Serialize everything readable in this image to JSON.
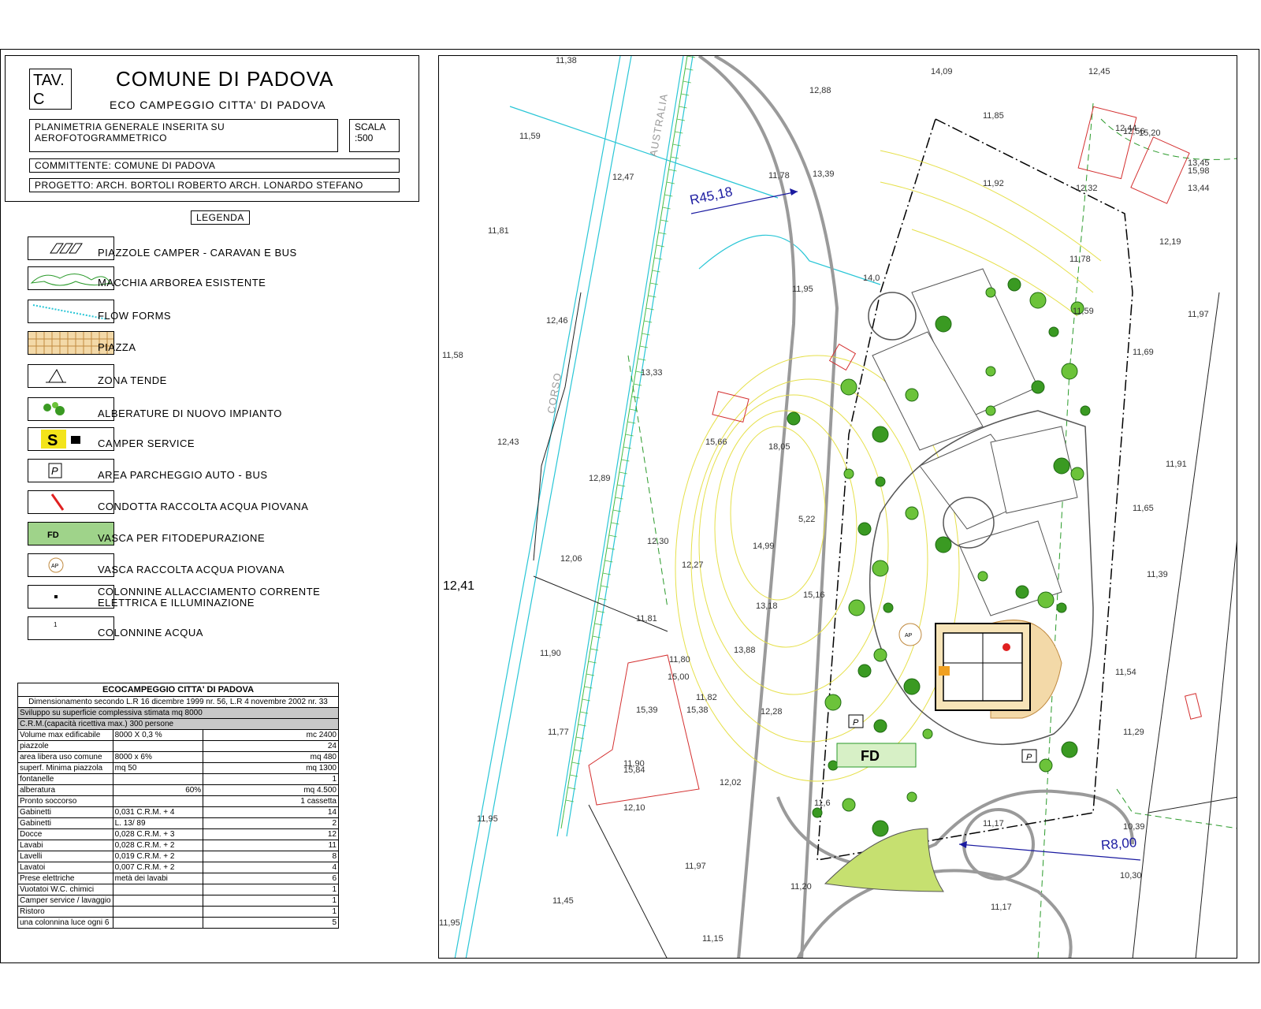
{
  "title": {
    "tav_line1": "TAV.",
    "tav_line2": "C",
    "comune": "COMUNE DI PADOVA",
    "subtitle": "ECO CAMPEGGIO CITTA' DI PADOVA",
    "plan_line1": "PLANIMETRIA GENERALE INSERITA SU",
    "plan_line2": "AEROFOTOGRAMMETRICO",
    "scala_label": "SCALA",
    "scala_value": ":500",
    "committente": "COMMITTENTE:   COMUNE DI PADOVA",
    "progetto": "PROGETTO:   ARCH. BORTOLI ROBERTO    ARCH. LONARDO STEFANO"
  },
  "legend": {
    "title": "LEGENDA",
    "items": [
      {
        "label": "PIAZZOLE CAMPER - CARAVAN E BUS",
        "icon": "camper-pitch-icon"
      },
      {
        "label": "MACCHIA ARBOREA ESISTENTE",
        "icon": "existing-woodland-icon"
      },
      {
        "label": "FLOW   FORMS",
        "icon": "flow-forms-icon"
      },
      {
        "label": "PIAZZA",
        "icon": "piazza-grid-icon"
      },
      {
        "label": "ZONA TENDE",
        "icon": "tent-icon"
      },
      {
        "label": "ALBERATURE DI NUOVO IMPIANTO",
        "icon": "new-trees-icon"
      },
      {
        "label": "CAMPER SERVICE",
        "icon": "camper-service-icon"
      },
      {
        "label": "AREA PARCHEGGIO AUTO - BUS",
        "icon": "parking-icon",
        "glyph": "P"
      },
      {
        "label": "CONDOTTA RACCOLTA ACQUA PIOVANA",
        "icon": "rainwater-pipe-icon"
      },
      {
        "label": "VASCA PER FITODEPURAZIONE",
        "icon": "phytodepuration-tank-icon",
        "glyph": "FD"
      },
      {
        "label": "VASCA RACCOLTA  ACQUA PIOVANA",
        "icon": "rainwater-tank-icon",
        "glyph": "AP"
      },
      {
        "label": "COLONNINE ALLACCIAMENTO CORRENTE\nELETTRICA E ILLUMINAZIONE",
        "icon": "power-column-icon"
      },
      {
        "label": "COLONNINE ACQUA",
        "icon": "water-column-icon",
        "glyph": "1"
      }
    ]
  },
  "table": {
    "title": "ECOCAMPEGGIO CITTA' DI PADOVA",
    "subtitle": "Dimensionamento secondo L.R 16 dicembre 1999 nr. 56, L.R 4 novembre 2002  nr. 33",
    "note1": "Sviluppo su superficie complessiva stimata mq 8000",
    "note2": "C.R.M.(capacità ricettiva max.) 300 persone",
    "rows": [
      [
        "Volume max edificabile",
        "8000 X 0,3 %",
        "mc 2400"
      ],
      [
        "piazzole",
        "",
        "24"
      ],
      [
        "area libera uso comune",
        "8000 x 6%",
        "mq 480"
      ],
      [
        "superf. Minima piazzola",
        "mq 50",
        "mq 1300"
      ],
      [
        "fontanelle",
        "",
        "1"
      ],
      [
        "alberatura",
        "60%",
        "mq 4.500"
      ],
      [
        "Pronto soccorso",
        "",
        "1 cassetta"
      ],
      [
        "Gabinetti",
        "0,031 C.R.M. + 4",
        "14"
      ],
      [
        "Gabinetti",
        "L. 13/ 89",
        "2"
      ],
      [
        "Docce",
        "0,028 C.R.M. + 3",
        "12"
      ],
      [
        "Lavabi",
        "0,028 C.R.M. + 2",
        "11"
      ],
      [
        "Lavelli",
        "0,019 C.R.M. + 2",
        "8"
      ],
      [
        "Lavatoi",
        "0,007 C.R.M. + 2",
        "4"
      ],
      [
        "Prese elettriche",
        "metà dei lavabi",
        "6"
      ],
      [
        "Vuotatoi W.C. chimici",
        "",
        "1"
      ],
      [
        "Camper service / lavaggio",
        "",
        "1"
      ],
      [
        "Ristoro",
        "",
        "1"
      ],
      [
        "una colonnina luce ogni 6",
        "",
        "5"
      ]
    ]
  },
  "map": {
    "radius_big": "R45,18",
    "radius_small": "R8,00",
    "street1": "AUSTRALIA",
    "street2": "CORSO",
    "label_fd": "FD",
    "label_ap": "AP",
    "label_p": "P",
    "spot_large": "12,41",
    "spots": [
      "11,38",
      "12,88",
      "14,09",
      "12,45",
      "11,85",
      "12,44",
      "12,56",
      "15,20",
      "13,45",
      "15,98",
      "13,44",
      "11,59",
      "12,47",
      "11,78",
      "13,39",
      "11,92",
      "12,32",
      "12,19",
      "11,81",
      "14,0",
      "11,78",
      "11,95",
      "11,97",
      "12,46",
      "11,69",
      "11,58",
      "13,33",
      "11,59",
      "12,43",
      "15,66",
      "18,05",
      "11,91",
      "12,89",
      "5,22",
      "11,65",
      "12,30",
      "14,99",
      "12,27",
      "12,06",
      "11,39",
      "15,16",
      "13,18",
      "11,81",
      "13,88",
      "11,54",
      "11,90",
      "11,80",
      "15,00",
      "11,82",
      "15,39",
      "15,38",
      "12,28",
      "11,29",
      "11,77",
      "11,90",
      "15,84",
      "12,02",
      "11,6",
      "12,10",
      "11,95",
      "11,17",
      "10,39",
      "11,97",
      "11,20",
      "10,30",
      "11,45",
      "11,17",
      "11,95",
      "11,15"
    ]
  }
}
